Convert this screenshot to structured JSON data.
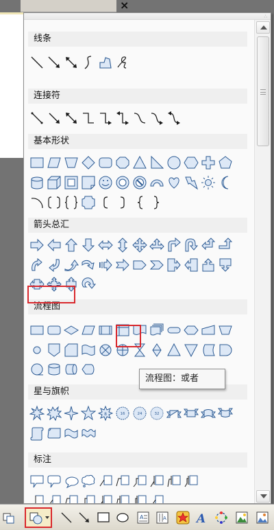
{
  "window": {
    "close_glyph": "×"
  },
  "sections": [
    {
      "id": "lines",
      "title": "线条"
    },
    {
      "id": "connectors",
      "title": "连接符"
    },
    {
      "id": "basic",
      "title": "基本形状"
    },
    {
      "id": "arrows",
      "title": "箭头总汇"
    },
    {
      "id": "flowchart",
      "title": "流程图"
    },
    {
      "id": "stars",
      "title": "星与旗帜"
    },
    {
      "id": "callouts",
      "title": "标注"
    }
  ],
  "tooltip": {
    "text": "流程图：或者"
  },
  "highlight": {
    "section": "流程图",
    "shape": "flowchart-or-icon"
  },
  "colors": {
    "highlight_red": "#d9262b",
    "shape_fill": "#dde8f6",
    "shape_stroke": "#2c5a93",
    "tooltip_bg": "#f7f7f7"
  },
  "toolbar": {
    "icons": [
      "select-objects-icon",
      "autoshapes-menu-icon",
      "line-tool-icon",
      "arrow-tool-icon",
      "rectangle-tool-icon",
      "oval-tool-icon",
      "textbox-icon",
      "vertical-textbox-icon",
      "wordart-icon",
      "diagram-icon",
      "clipart-icon",
      "picture-icon"
    ]
  }
}
